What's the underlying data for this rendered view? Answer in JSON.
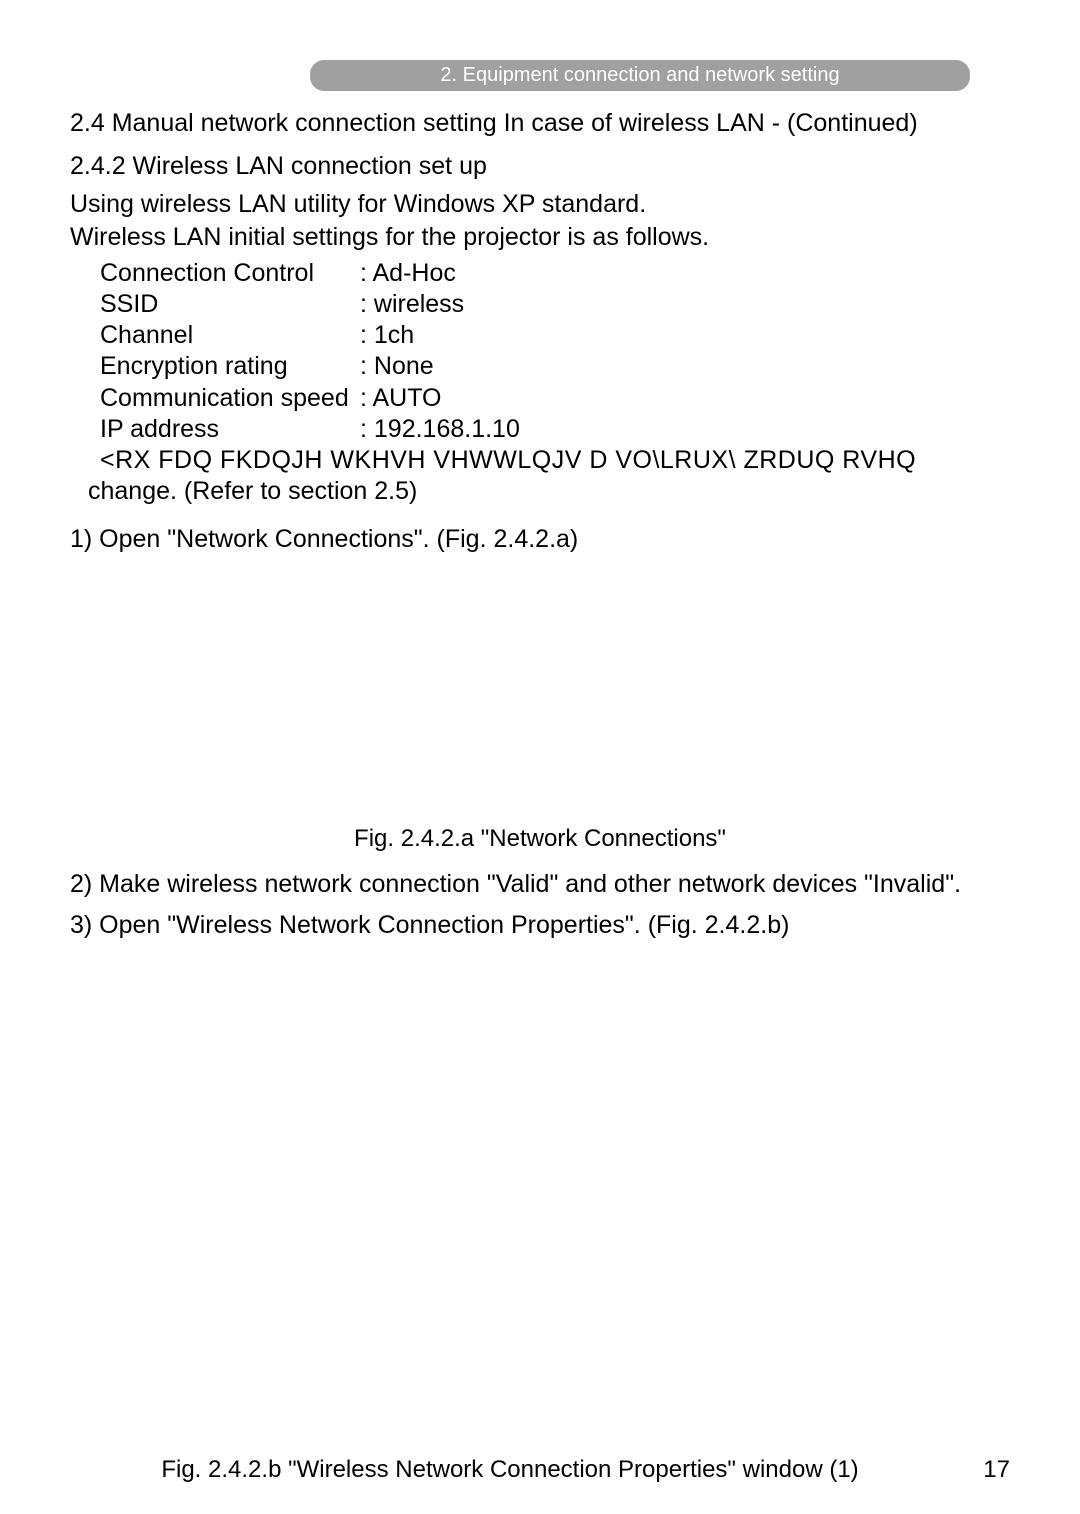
{
  "header": {
    "breadcrumb": "2. Equipment connection and network setting"
  },
  "section": {
    "title": "2.4 Manual network connection setting   In case of wireless LAN - (Continued)",
    "subtitle": "2.4.2 Wireless LAN connection set up",
    "intro1": "Using wireless LAN utility for Windows XP standard.",
    "intro2": "Wireless LAN initial settings for the projector is as follows."
  },
  "settings": {
    "rows": [
      {
        "label": "Connection Control",
        "value": ": Ad-Hoc"
      },
      {
        "label": "SSID",
        "value": ": wireless"
      },
      {
        "label": "Channel",
        "value": ": 1ch"
      },
      {
        "label": "Encryption rating",
        "value": ": None"
      },
      {
        "label": "Communication speed",
        "value": ": AUTO"
      },
      {
        "label": "IP address",
        "value": ": 192.168.1.10"
      }
    ],
    "star_line": "<RX  FDQ  FKDQJH  WKHVH  VHWWLQJV  D VO\\LRUX\\ ZRDUQ RVHQ",
    "change_line": "change. (Refer to section 2.5)"
  },
  "steps": {
    "step1": "1) Open \"Network Connections\". (Fig. 2.4.2.a)",
    "fig_a_caption": "Fig. 2.4.2.a \"Network Connections\"",
    "step2": "2) Make wireless network connection \"Valid\" and other network devices \"Invalid\".",
    "step3": "3) Open \"Wireless Network Connection Properties\". (Fig. 2.4.2.b)"
  },
  "footer": {
    "fig_b_caption": "Fig. 2.4.2.b \"Wireless Network Connection Properties\" window (1)",
    "page": "17"
  }
}
